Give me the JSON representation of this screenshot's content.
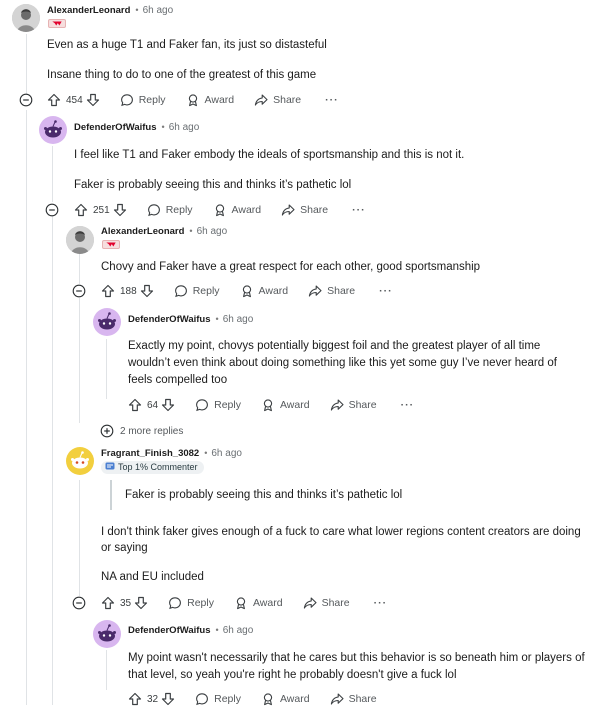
{
  "comments": [
    {
      "author": "AlexanderLeonard",
      "time": "6h ago",
      "flair": "t1-flair-icon",
      "paragraphs": [
        "Even as a huge T1 and Faker fan, its just so distasteful",
        "Insane thing to do to one of the greatest of this game"
      ],
      "score": "454"
    },
    {
      "author": "DefenderOfWaifus",
      "time": "6h ago",
      "paragraphs": [
        "I feel like T1 and Faker embody the ideals of sportsmanship and this is not it.",
        "Faker is probably seeing this and thinks it’s pathetic lol"
      ],
      "score": "251"
    },
    {
      "author": "AlexanderLeonard",
      "time": "6h ago",
      "flair": "t1-flair-icon",
      "paragraphs": [
        "Chovy and Faker have a great respect for each other, good sportsmanship"
      ],
      "score": "188"
    },
    {
      "author": "DefenderOfWaifus",
      "time": "6h ago",
      "paragraphs": [
        "Exactly my point, chovys potentially biggest foil and the greatest player of all time",
        "wouldn’t even think about doing something like this yet some guy I’ve never heard of",
        "feels compelled too"
      ],
      "score": "64"
    },
    {
      "author": "Fragrant_Finish_3082",
      "time": "6h ago",
      "badge": "Top 1% Commenter",
      "quote": "Faker is probably seeing this and thinks it’s pathetic lol",
      "paragraphs": [
        "I don't think faker gives enough of a fuck to care what lower regions content creators are doing",
        "or saying",
        "NA and EU included"
      ],
      "score": "35"
    },
    {
      "author": "DefenderOfWaifus",
      "time": "6h ago",
      "paragraphs": [
        "My point wasn't necessarily that he cares but this behavior is so beneath him or players of",
        "that level, so yeah you're right he probably doesn't give a fuck lol"
      ],
      "score": "32"
    }
  ],
  "actions": {
    "reply": "Reply",
    "award": "Award",
    "share": "Share",
    "more": "···"
  },
  "more_replies": "2 more replies",
  "separator": "•"
}
